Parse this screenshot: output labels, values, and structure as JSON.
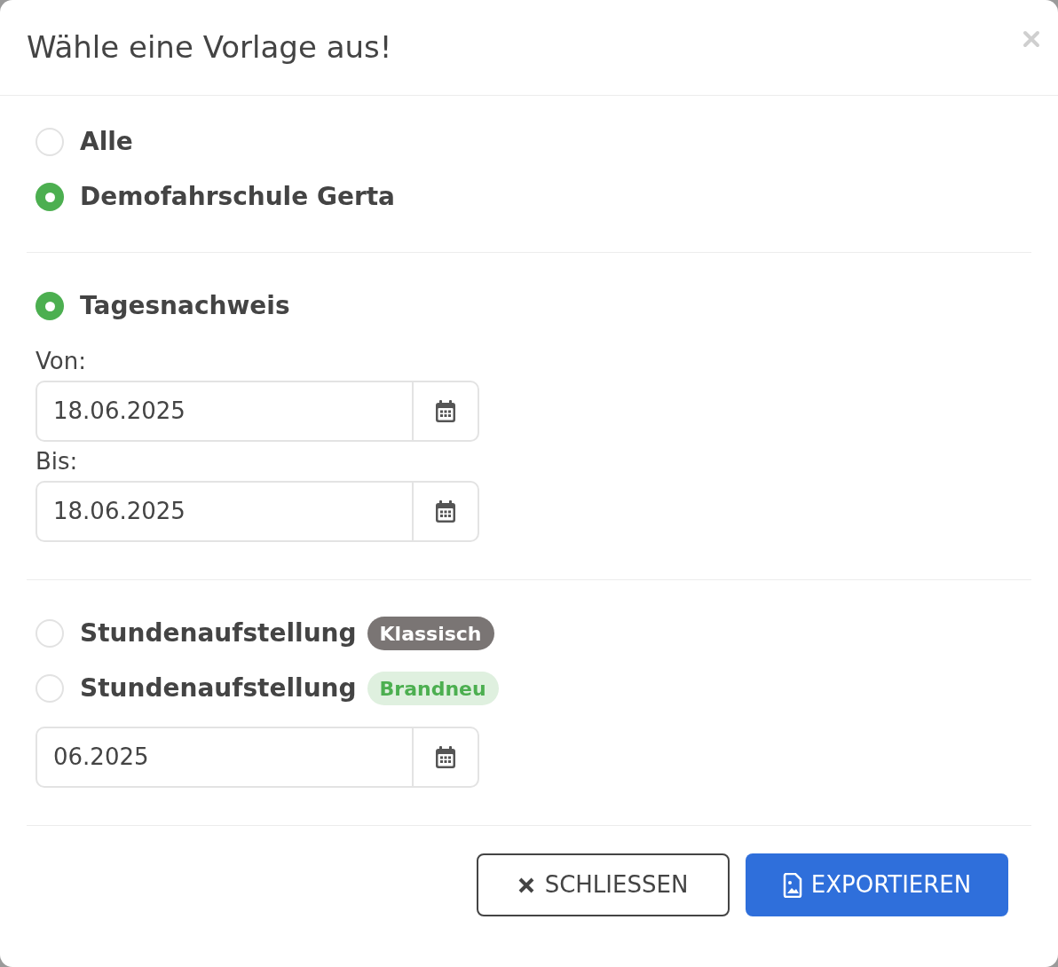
{
  "dialog": {
    "title": "Wähle eine Vorlage aus!"
  },
  "sections": [
    {
      "options": [
        {
          "label": "Alle",
          "selected": false
        },
        {
          "label": "Demofahrschule Gerta",
          "selected": true
        }
      ]
    },
    {
      "options": [
        {
          "label": "Tagesnachweis",
          "selected": true
        }
      ],
      "fields": [
        {
          "label": "Von:",
          "value": "18.06.2025"
        },
        {
          "label": "Bis:",
          "value": "18.06.2025"
        }
      ]
    },
    {
      "options": [
        {
          "label": "Stundenaufstellung",
          "selected": false,
          "badge": {
            "text": "Klassisch",
            "kind": "classic"
          }
        },
        {
          "label": "Stundenaufstellung",
          "selected": false,
          "badge": {
            "text": "Brandneu",
            "kind": "new"
          }
        }
      ],
      "fields": [
        {
          "value": "06.2025"
        }
      ]
    }
  ],
  "buttons": [
    {
      "label": "SCHLIESSEN",
      "kind": "close"
    },
    {
      "label": "EXPORTIEREN",
      "kind": "export"
    }
  ]
}
